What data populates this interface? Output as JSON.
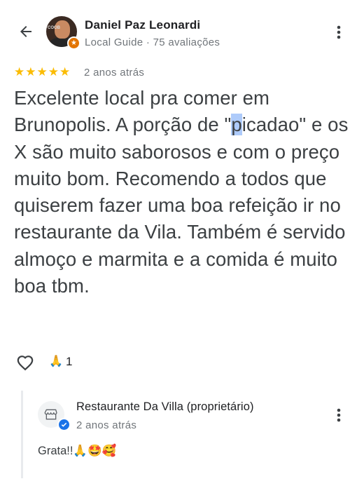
{
  "reviewer": {
    "name": "Daniel Paz Leonardi",
    "subtitle": "Local Guide · 75 avaliações"
  },
  "review": {
    "rating": 5,
    "date": "2 anos atrás",
    "text_before": "Excelente local pra comer em Brunopolis. A porção de \"",
    "text_highlight": "p",
    "text_after": "icadao\" e os X são muito saborosos e com o preço muito bom. Recomendo a todos que quiserem fazer uma boa refeição ir no restaurante da Vila. Também é servido almoço e marmita e a comida é muito boa tbm.",
    "reaction_emoji": "🙏",
    "reaction_count": "1"
  },
  "owner_reply": {
    "name": "Restaurante Da Villa (proprietário)",
    "date": "2 anos atrás",
    "text": "Grata!!🙏🤩🥰"
  },
  "icons": {
    "back": "back-arrow-icon",
    "more": "more-vert-icon",
    "like": "heart-outline-icon",
    "store": "storefront-icon",
    "verified": "verified-check-icon",
    "local_guide": "local-guide-star-icon"
  },
  "colors": {
    "star": "#fbbc04",
    "secondary_text": "#70757a",
    "verified": "#1a73e8",
    "local_guide_badge": "#e37400",
    "selection_highlight": "#aecbfa"
  }
}
